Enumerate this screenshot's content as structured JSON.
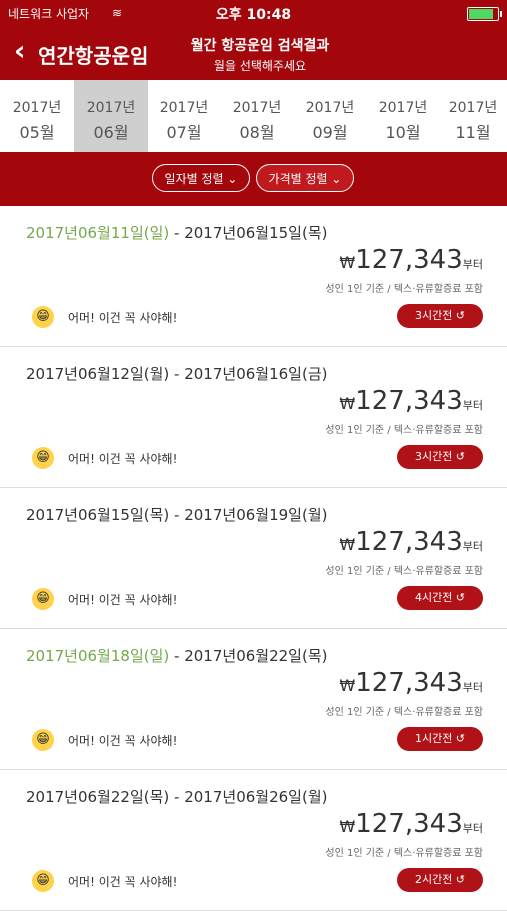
{
  "status_bar": {
    "carrier": "네트워크 사업자",
    "wifi": "≋",
    "time": "오후 10:48"
  },
  "nav": {
    "back_icon": "chevron-left-icon",
    "title": "연간항공운임",
    "header_title": "월간 항공운임 검색결과",
    "header_subtitle": "월을 선택해주세요"
  },
  "months": [
    {
      "year": "2017년",
      "month": "05월",
      "selected": false
    },
    {
      "year": "2017년",
      "month": "06월",
      "selected": true
    },
    {
      "year": "2017년",
      "month": "07월",
      "selected": false
    },
    {
      "year": "2017년",
      "month": "08월",
      "selected": false
    },
    {
      "year": "2017년",
      "month": "09월",
      "selected": false
    },
    {
      "year": "2017년",
      "month": "10월",
      "selected": false
    },
    {
      "year": "2017년",
      "month": "11월",
      "selected": false
    }
  ],
  "sort": {
    "date_label": "일자별 정렬 ⌄",
    "price_label": "가격별 정렬 ⌄"
  },
  "results": [
    {
      "from": "2017년06월11일(일)",
      "to": "2017년06월15일(목)",
      "from_green": true,
      "currency": "₩",
      "price": "127,343",
      "suffix": "부터",
      "sub": "성인 1인 기준 / 텍스·유류할증료 포함",
      "promo": "어머! 이건 꼭 사야해!",
      "ago": "3시간전 ↺"
    },
    {
      "from": "2017년06월12일(월)",
      "to": "2017년06월16일(금)",
      "from_green": false,
      "currency": "₩",
      "price": "127,343",
      "suffix": "부터",
      "sub": "성인 1인 기준 / 텍스·유류할증료 포함",
      "promo": "어머! 이건 꼭 사야해!",
      "ago": "3시간전 ↺"
    },
    {
      "from": "2017년06월15일(목)",
      "to": "2017년06월19일(월)",
      "from_green": false,
      "currency": "₩",
      "price": "127,343",
      "suffix": "부터",
      "sub": "성인 1인 기준 / 텍스·유류할증료 포함",
      "promo": "어머! 이건 꼭 사야해!",
      "ago": "4시간전 ↺"
    },
    {
      "from": "2017년06월18일(일)",
      "to": "2017년06월22일(목)",
      "from_green": true,
      "currency": "₩",
      "price": "127,343",
      "suffix": "부터",
      "sub": "성인 1인 기준 / 텍스·유류할증료 포함",
      "promo": "어머! 이건 꼭 사야해!",
      "ago": "1시간전 ↺"
    },
    {
      "from": "2017년06월22일(목)",
      "to": "2017년06월26일(월)",
      "from_green": false,
      "currency": "₩",
      "price": "127,343",
      "suffix": "부터",
      "sub": "성인 1인 기준 / 텍스·유류할증료 포함",
      "promo": "어머! 이건 꼭 사야해!",
      "ago": "2시간전 ↺"
    }
  ],
  "colors": {
    "brand": "#a3060b",
    "accent_green": "#74a84a",
    "badge": "#b11217"
  }
}
